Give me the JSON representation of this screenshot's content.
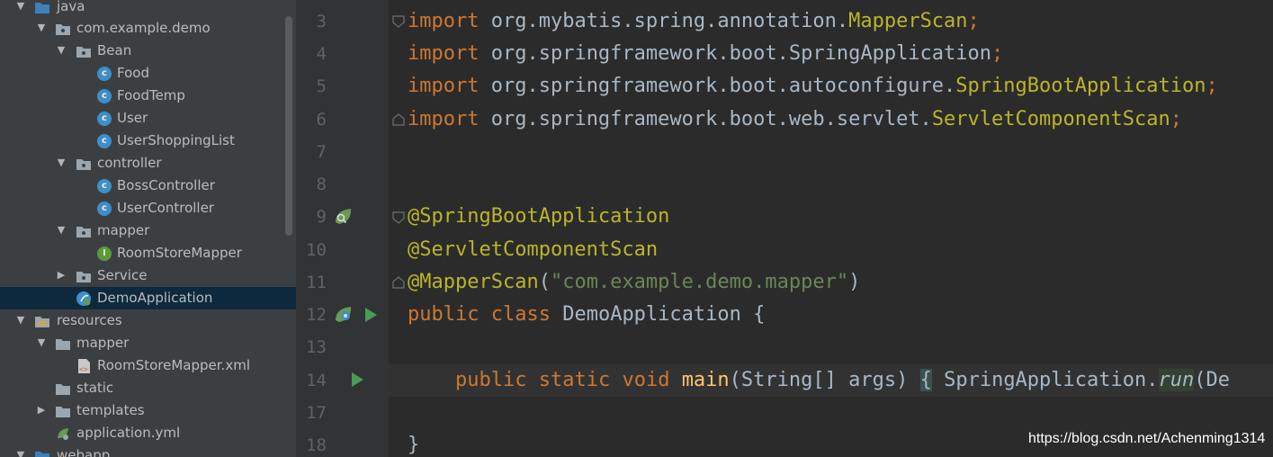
{
  "project_tree": {
    "items": [
      {
        "label": "java",
        "icon": "source-folder-icon",
        "arrow": "expanded"
      },
      {
        "label": "com.example.demo",
        "icon": "package-icon",
        "arrow": "expanded"
      },
      {
        "label": "Bean",
        "icon": "package-icon",
        "arrow": "expanded"
      },
      {
        "label": "Food",
        "icon": "class-icon",
        "arrow": "none"
      },
      {
        "label": "FoodTemp",
        "icon": "class-icon",
        "arrow": "none"
      },
      {
        "label": "User",
        "icon": "class-icon",
        "arrow": "none"
      },
      {
        "label": "UserShoppingList",
        "icon": "class-icon",
        "arrow": "none"
      },
      {
        "label": "controller",
        "icon": "package-icon",
        "arrow": "expanded"
      },
      {
        "label": "BossController",
        "icon": "class-icon",
        "arrow": "none"
      },
      {
        "label": "UserController",
        "icon": "class-icon",
        "arrow": "none"
      },
      {
        "label": "mapper",
        "icon": "package-icon",
        "arrow": "expanded"
      },
      {
        "label": "RoomStoreMapper",
        "icon": "interface-icon",
        "arrow": "none"
      },
      {
        "label": "Service",
        "icon": "package-icon",
        "arrow": "collapsed"
      },
      {
        "label": "DemoApplication",
        "icon": "spring-boot-class-icon",
        "arrow": "none",
        "selected": true
      },
      {
        "label": "resources",
        "icon": "resources-folder-icon",
        "arrow": "expanded"
      },
      {
        "label": "mapper",
        "icon": "folder-icon",
        "arrow": "expanded"
      },
      {
        "label": "RoomStoreMapper.xml",
        "icon": "xml-file-icon",
        "arrow": "none"
      },
      {
        "label": "static",
        "icon": "folder-icon",
        "arrow": "none"
      },
      {
        "label": "templates",
        "icon": "folder-icon",
        "arrow": "collapsed"
      },
      {
        "label": "application.yml",
        "icon": "yaml-spring-icon",
        "arrow": "none"
      },
      {
        "label": "webapp",
        "icon": "web-folder-icon",
        "arrow": "expanded"
      }
    ]
  },
  "editor": {
    "line_numbers": [
      "3",
      "4",
      "5",
      "6",
      "7",
      "8",
      "9",
      "10",
      "11",
      "12",
      "13",
      "14",
      "17",
      "18"
    ],
    "code": {
      "l3": {
        "kw": "import",
        "pkg": " org.mybatis.spring.annotation.",
        "cls": "MapperScan",
        "semi": ";"
      },
      "l4": {
        "kw": "import",
        "pkg": " org.springframework.boot.SpringApplication",
        "semi": ";"
      },
      "l5": {
        "kw": "import",
        "pkg": " org.springframework.boot.autoconfigure.",
        "cls": "SpringBootApplication",
        "semi": ";"
      },
      "l6": {
        "kw": "import",
        "pkg": " org.springframework.boot.web.servlet.",
        "cls": "ServletComponentScan",
        "semi": ";"
      },
      "l9": {
        "ann": "@SpringBootApplication"
      },
      "l10": {
        "ann": "@ServletComponentScan"
      },
      "l11": {
        "ann": "@MapperScan",
        "open": "(",
        "str": "\"com.example.demo.mapper\"",
        "close": ")"
      },
      "l12": {
        "kw1": "public",
        "kw2": "class",
        "name": " DemoApplication {"
      },
      "l14": {
        "kw1": "public",
        "kw2": "static",
        "kw3": "void",
        "fn": "main",
        "params": "(String[] args) ",
        "lbrace": "{",
        "call": " SpringApplication.",
        "run": "run",
        "rest": "(De"
      },
      "l18": {
        "text": "}"
      }
    }
  },
  "watermark": "https://blog.csdn.net/Achenming1314",
  "colors": {
    "keyword": "#cc7832",
    "annotation": "#bbb529",
    "string": "#6a8759",
    "function": "#ffc66d",
    "text": "#a9b7c6",
    "line_number": "#606366",
    "selection": "#0d293e",
    "tree_background": "#3c3f41",
    "editor_background": "#2b2b2b"
  }
}
